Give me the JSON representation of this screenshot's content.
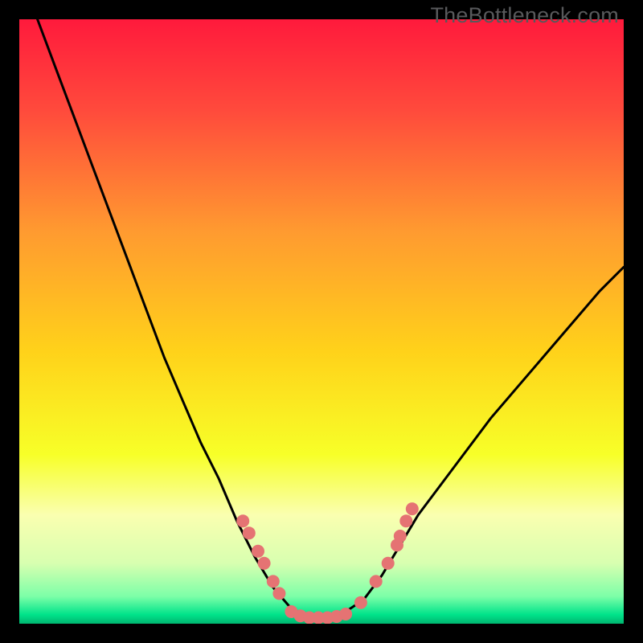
{
  "watermark": "TheBottleneck.com",
  "colors": {
    "bg": "#000000",
    "curve": "#000000",
    "marker": "#e57373",
    "watermark": "#58595b"
  },
  "chart_data": {
    "type": "line",
    "title": "",
    "xlabel": "",
    "ylabel": "",
    "xlim": [
      0,
      100
    ],
    "ylim": [
      0,
      100
    ],
    "gradient_stops": [
      {
        "offset": 0.0,
        "color": "#ff1a3c"
      },
      {
        "offset": 0.15,
        "color": "#ff4a3c"
      },
      {
        "offset": 0.35,
        "color": "#ff9a30"
      },
      {
        "offset": 0.55,
        "color": "#ffd21a"
      },
      {
        "offset": 0.72,
        "color": "#f7ff28"
      },
      {
        "offset": 0.82,
        "color": "#faffb0"
      },
      {
        "offset": 0.9,
        "color": "#d8ffb0"
      },
      {
        "offset": 0.955,
        "color": "#7cffa8"
      },
      {
        "offset": 0.985,
        "color": "#00e38a"
      },
      {
        "offset": 1.0,
        "color": "#00b56f"
      }
    ],
    "series": [
      {
        "name": "bottleneck-curve",
        "points": [
          {
            "x": 3.0,
            "y": 100.0
          },
          {
            "x": 6.0,
            "y": 92.0
          },
          {
            "x": 9.0,
            "y": 84.0
          },
          {
            "x": 12.0,
            "y": 76.0
          },
          {
            "x": 15.0,
            "y": 68.0
          },
          {
            "x": 18.0,
            "y": 60.0
          },
          {
            "x": 21.0,
            "y": 52.0
          },
          {
            "x": 24.0,
            "y": 44.0
          },
          {
            "x": 27.0,
            "y": 37.0
          },
          {
            "x": 30.0,
            "y": 30.0
          },
          {
            "x": 33.0,
            "y": 24.0
          },
          {
            "x": 36.0,
            "y": 17.0
          },
          {
            "x": 39.0,
            "y": 11.0
          },
          {
            "x": 42.0,
            "y": 6.0
          },
          {
            "x": 45.0,
            "y": 2.5
          },
          {
            "x": 48.0,
            "y": 1.2
          },
          {
            "x": 51.0,
            "y": 1.2
          },
          {
            "x": 54.0,
            "y": 2.0
          },
          {
            "x": 57.0,
            "y": 4.0
          },
          {
            "x": 60.0,
            "y": 8.0
          },
          {
            "x": 63.0,
            "y": 13.0
          },
          {
            "x": 66.0,
            "y": 18.0
          },
          {
            "x": 72.0,
            "y": 26.0
          },
          {
            "x": 78.0,
            "y": 34.0
          },
          {
            "x": 84.0,
            "y": 41.0
          },
          {
            "x": 90.0,
            "y": 48.0
          },
          {
            "x": 96.0,
            "y": 55.0
          },
          {
            "x": 100.0,
            "y": 59.0
          }
        ]
      }
    ],
    "markers": [
      {
        "x": 37.0,
        "y": 17.0
      },
      {
        "x": 38.0,
        "y": 15.0
      },
      {
        "x": 39.5,
        "y": 12.0
      },
      {
        "x": 40.5,
        "y": 10.0
      },
      {
        "x": 42.0,
        "y": 7.0
      },
      {
        "x": 43.0,
        "y": 5.0
      },
      {
        "x": 45.0,
        "y": 2.0
      },
      {
        "x": 46.5,
        "y": 1.3
      },
      {
        "x": 48.0,
        "y": 1.0
      },
      {
        "x": 49.5,
        "y": 1.0
      },
      {
        "x": 51.0,
        "y": 1.0
      },
      {
        "x": 52.5,
        "y": 1.2
      },
      {
        "x": 54.0,
        "y": 1.6
      },
      {
        "x": 56.5,
        "y": 3.5
      },
      {
        "x": 59.0,
        "y": 7.0
      },
      {
        "x": 61.0,
        "y": 10.0
      },
      {
        "x": 62.5,
        "y": 13.0
      },
      {
        "x": 63.0,
        "y": 14.5
      },
      {
        "x": 64.0,
        "y": 17.0
      },
      {
        "x": 65.0,
        "y": 19.0
      }
    ]
  }
}
